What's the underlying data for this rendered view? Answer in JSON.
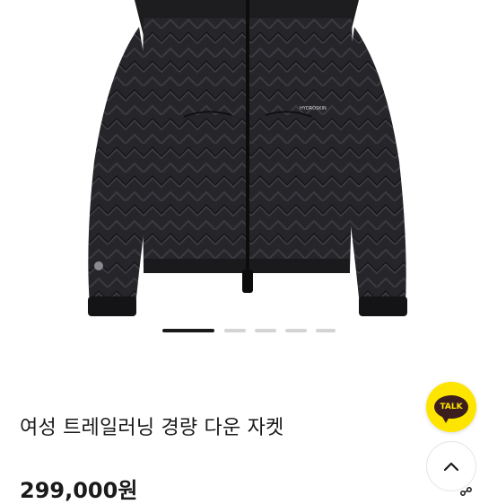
{
  "product": {
    "title": "여성 트레일러닝 경량 다운 자켓",
    "price": "299,000원",
    "image_brand_text": "HYDROSKIN"
  },
  "gallery": {
    "total_images": 5,
    "active_index": 1
  },
  "floating": {
    "kakao_label": "TALK",
    "kakao_color": "#fee500",
    "scroll_top_icon": "chevron-up-icon"
  }
}
